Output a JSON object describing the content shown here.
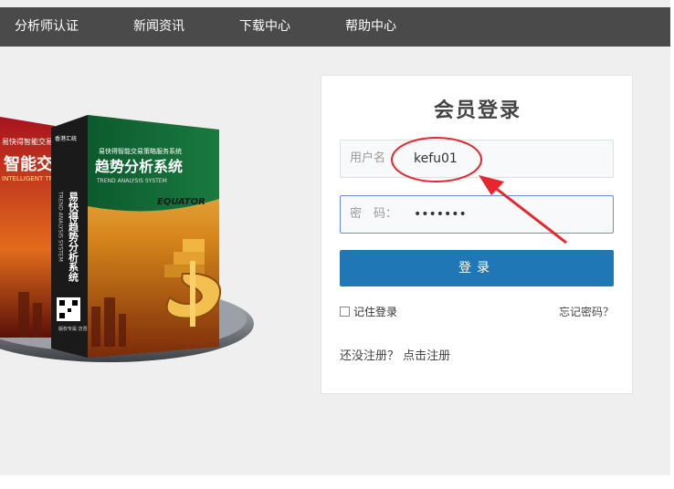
{
  "nav": {
    "items": [
      {
        "label": "分析师认证"
      },
      {
        "label": "新闻资讯"
      },
      {
        "label": "下载中心"
      },
      {
        "label": "帮助中心"
      }
    ]
  },
  "hero": {
    "box_top_text": "易快得智能交易策略服务系统",
    "box_title": "趋势分析系统",
    "box_subtitle": "TREND ANALYSIS SYSTEM",
    "box_side_title": "易快得趋势分析系统",
    "box_side_en": "TREND ANALYSIS SYSTEM",
    "brand_logo": "香港汇统",
    "brand_name": "EQUATOR",
    "left_box_text": "智能交易",
    "left_box_top": "易快得智能交易策略",
    "left_box_en": "INTELLIGENT TRAD",
    "copyright": "版权专属 仿冒必究"
  },
  "login": {
    "title": "会员登录",
    "username_label": "用户名",
    "username_value": "kefu01",
    "password_label": "密　码：",
    "password_value": "•••••••",
    "submit_label": "登录",
    "remember_label": "记住登录",
    "forgot_label": "忘记密码？",
    "register_prompt": "还没注册？",
    "register_link": "点击注册"
  },
  "colors": {
    "navbar_bg": "#4a4a4a",
    "login_button": "#1f77b6",
    "annotation": "#e8262d"
  }
}
